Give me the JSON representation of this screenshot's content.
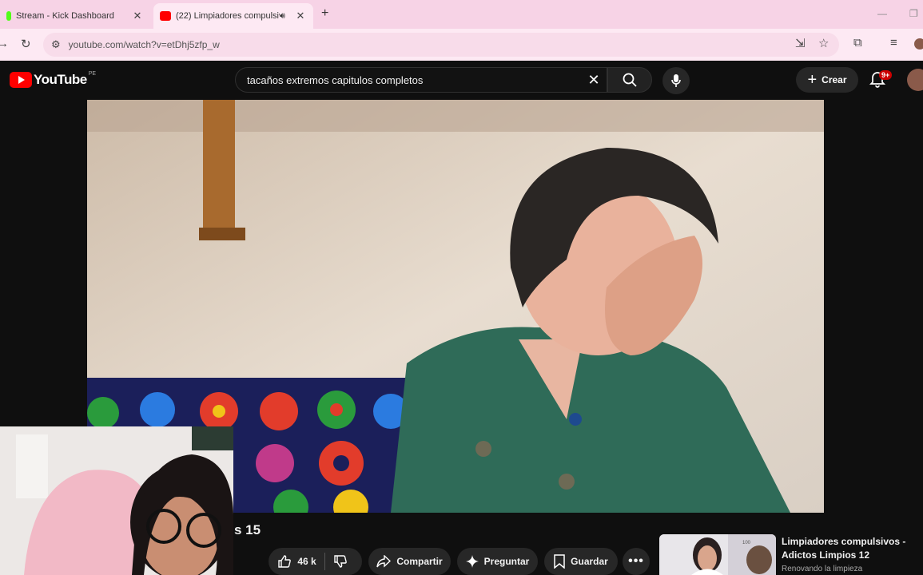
{
  "browser": {
    "tabs": [
      {
        "title": "Stream - Kick Dashboard",
        "active": false,
        "favicon_color": "#53fc18"
      },
      {
        "title": "(22) Limpiadores compulsivos",
        "active": true,
        "favicon_color": "#ff0000"
      }
    ],
    "url": "youtube.com/watch?v=etDhj5zfp_w"
  },
  "youtube": {
    "logo_text": "YouTube",
    "country_code": "PE",
    "search_query": "tacaños extremos capitulos completos",
    "create_label": "Crear",
    "notification_badge": "9+"
  },
  "video": {
    "title_visible": "s 15",
    "like_count": "46 k",
    "share_label": "Compartir",
    "ask_label": "Preguntar",
    "save_label": "Guardar"
  },
  "recommendation": {
    "title": "Limpiadores compulsivos - Adictos Limpios 12",
    "channel": "Renovando la limpieza",
    "thumb_badge": "100"
  },
  "colors": {
    "brand_red": "#ff0000",
    "tabbar_pink": "#f7d3e6",
    "yt_background": "#0f0f0f",
    "pill_gray": "#272727"
  }
}
